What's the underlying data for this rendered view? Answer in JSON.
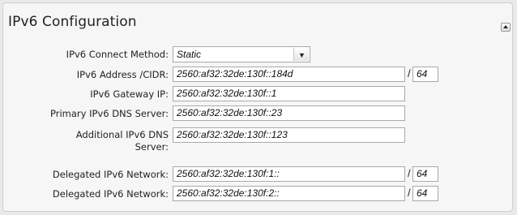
{
  "panel": {
    "title": "IPv6 Configuration",
    "collapse_icon": "chevron-up-icon"
  },
  "fields": {
    "connect_method": {
      "label": "IPv6 Connect Method:",
      "value": "Static",
      "dropdown_icon": "chevron-down-icon"
    },
    "address": {
      "label": "IPv6 Address /CIDR:",
      "value": "2560:af32:32de:130f::184d",
      "prefix_separator": "/",
      "prefix": "64"
    },
    "gateway": {
      "label": "IPv6 Gateway IP:",
      "value": "2560:af32:32de:130f::1"
    },
    "primary_dns": {
      "label": "Primary IPv6 DNS Server:",
      "value": "2560:af32:32de:130f::23"
    },
    "additional_dns": {
      "label_line1": "Additional IPv6 DNS",
      "label_line2": "Server:",
      "value": "2560:af32:32de:130f::123"
    },
    "delegated_1": {
      "label": "Delegated IPv6 Network:",
      "value": "2560:af32:32de:130f:1::",
      "prefix_separator": "/",
      "prefix": "64"
    },
    "delegated_2": {
      "label": "Delegated IPv6 Network:",
      "value": "2560:af32:32de:130f:2::",
      "prefix_separator": "/",
      "prefix": "64"
    }
  }
}
